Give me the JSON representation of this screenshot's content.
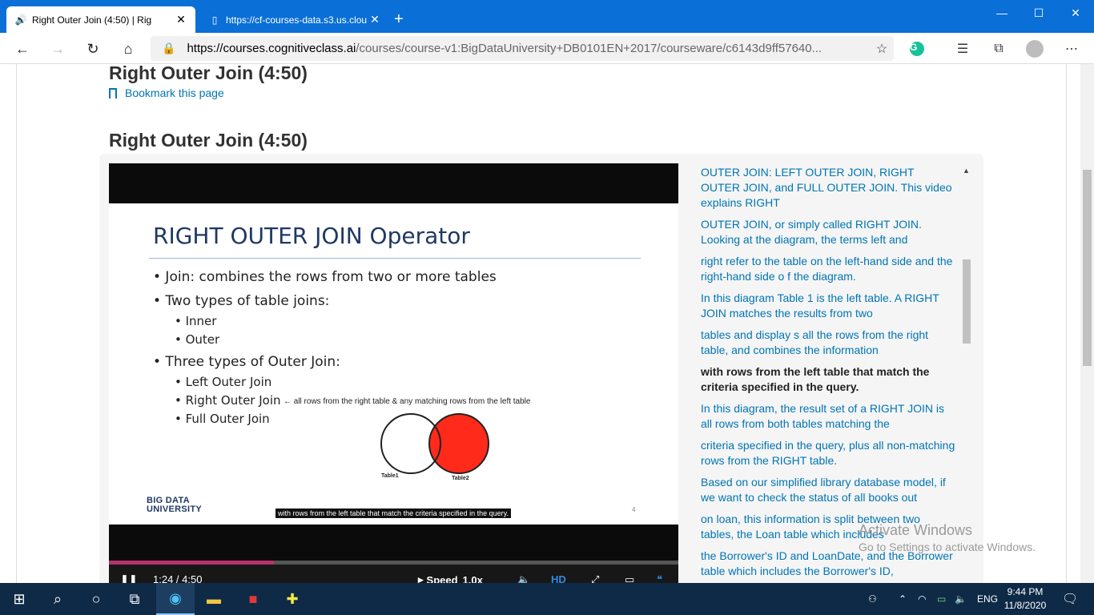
{
  "browser": {
    "tabs": [
      {
        "title": "Right Outer Join (4:50) | Rig",
        "active": true
      },
      {
        "title": "https://cf-courses-data.s3.us.clou",
        "active": false
      }
    ],
    "url_domain": "https://courses.cognitiveclass.ai",
    "url_path": "/courses/course-v1:BigDataUniversity+DB0101EN+2017/courseware/c6143d9ff57640..."
  },
  "page": {
    "unit_title": "Right Outer Join (4:50)",
    "bookmark_label": "Bookmark this page",
    "video_heading": "Right Outer Join (4:50)"
  },
  "slide": {
    "title": "RIGHT OUTER JOIN Operator",
    "bullets": [
      "• Join: combines the rows from two or more tables",
      "• Two types of table joins:",
      "• Inner",
      "• Outer",
      "• Three types of Outer Join:",
      "• Left Outer Join",
      "• Right Outer Join",
      "• Full Outer Join"
    ],
    "annotation": "← all rows from the right table & any matching rows from the left table",
    "venn_labels": [
      "Table1",
      "Table2"
    ],
    "logo_line1": "BIG DATA",
    "logo_line2": "UNIVERSITY",
    "slide_number": "4",
    "caption": "with rows from the left table that match the criteria specified in the query."
  },
  "player": {
    "time": "1:24 / 4:50",
    "progress": 0.29,
    "speed_label": "Speed",
    "speed_value": "1.0x",
    "hd_label": "HD",
    "accent": "#b5326b"
  },
  "transcript": [
    "OUTER JOIN: LEFT OUTER JOIN, RIGHT OUTER JOIN, and FULL OUTER JOIN. This video explains RIGHT",
    "OUTER JOIN, or simply called RIGHT JOIN. Looking at the diagram, the terms left and",
    "right refer to the table on the left-hand side and the right-hand side o f the diagram.",
    "In this diagram Table 1 is the left table. A RIGHT JOIN matches the results from two",
    "tables and display s all the rows from the right table, and combines the information",
    "with rows from the left table that match the criteria specified in the query.",
    "In this diagram, the result set of a RIGHT JOIN is all rows from both tables matching the",
    "criteria specified in the query, plus all non-matching rows from the RIGHT table.",
    "Based on our simplified library database model, if we want to check the status of all books out",
    "on loan, this information is split between two tables, the Loan table which includes",
    "the Borrower's ID and LoanDate, and the Borrower table which includes the Borrower's ID,"
  ],
  "transcript_current_index": 5,
  "windows": {
    "watermark_line1": "Activate Windows",
    "watermark_line2": "Go to Settings to activate Windows.",
    "language": "ENG",
    "time": "9:44 PM",
    "date": "11/8/2020"
  }
}
